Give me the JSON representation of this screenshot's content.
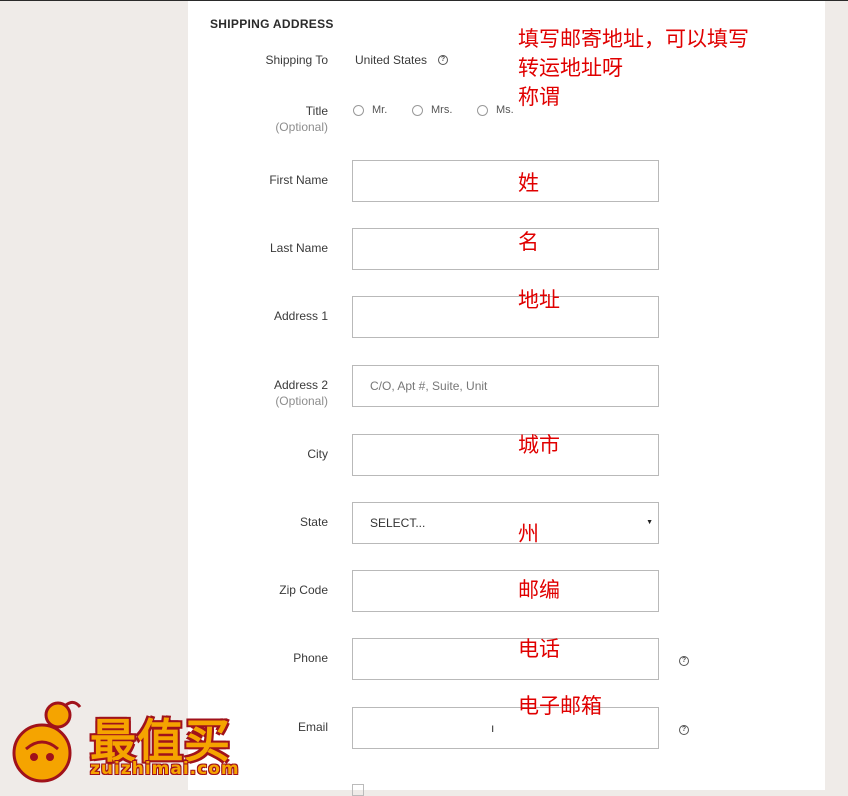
{
  "section": {
    "title": "SHIPPING ADDRESS"
  },
  "shipping_to": {
    "label": "Shipping To",
    "value": "United States",
    "help": "?"
  },
  "title_field": {
    "label": "Title",
    "optional": "(Optional)",
    "options": [
      "Mr.",
      "Mrs.",
      "Ms."
    ]
  },
  "fields": {
    "first_name": {
      "label": "First Name",
      "value": ""
    },
    "last_name": {
      "label": "Last Name",
      "value": ""
    },
    "address1": {
      "label": "Address 1",
      "value": ""
    },
    "address2": {
      "label": "Address 2",
      "optional": "(Optional)",
      "placeholder": "C/O, Apt #, Suite, Unit"
    },
    "city": {
      "label": "City",
      "value": ""
    },
    "state": {
      "label": "State",
      "selected": "SELECT..."
    },
    "zip": {
      "label": "Zip Code",
      "value": ""
    },
    "phone": {
      "label": "Phone",
      "value": "",
      "help": "?"
    },
    "email": {
      "label": "Email",
      "value": "ı",
      "help": "?"
    }
  },
  "annotations": {
    "header_line1": "填写邮寄地址，可以填写",
    "header_line2": "转运地址呀",
    "header_line3": "称谓",
    "first_name": "姓",
    "last_name": "名",
    "address1": "地址",
    "city": "城市",
    "state": "州",
    "zip": "邮编",
    "phone": "电话",
    "email": "电子邮箱"
  },
  "watermark": {
    "brand": "最值买",
    "url": "zuizhimai.com"
  },
  "colors": {
    "annotation": "#e00000",
    "background": "#efebe8",
    "panel": "#ffffff",
    "logo_orange": "#f5a400",
    "logo_red": "#a0121b"
  }
}
